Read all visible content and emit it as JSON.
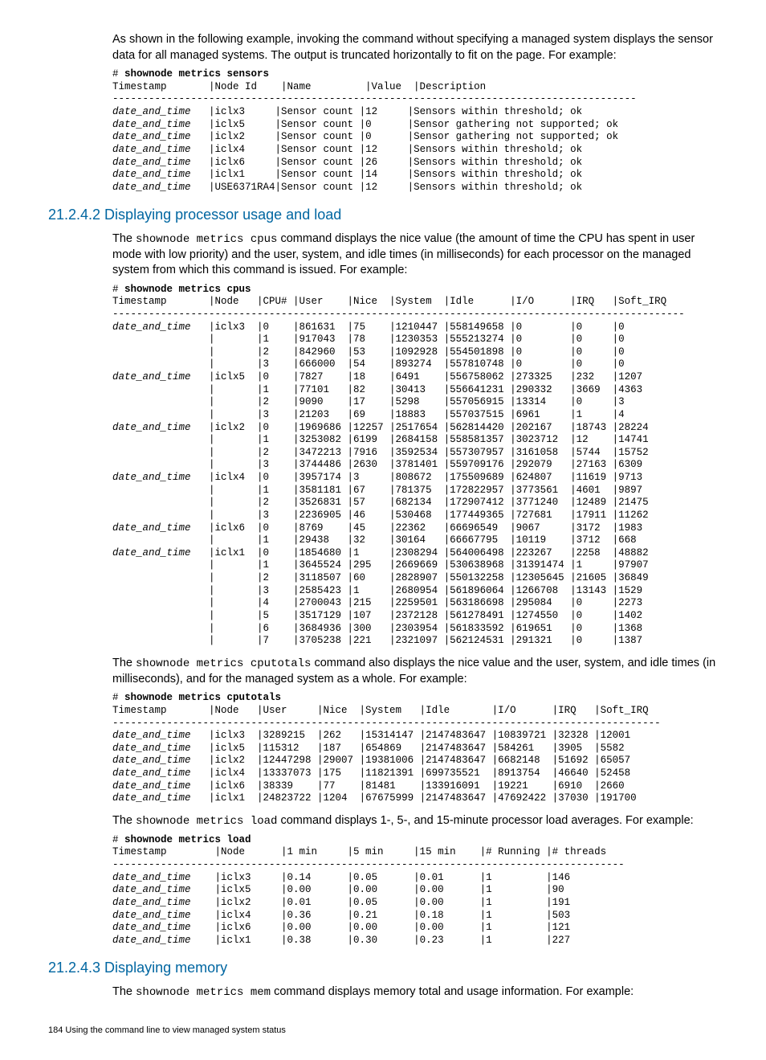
{
  "intro_para": "As shown in the following example, invoking the command without specifying a managed system displays the sensor data for all managed systems. The output is truncated horizontally to fit on the page. For example:",
  "sensors_block": {
    "cmd": "# shownode metrics sensors",
    "header": "Timestamp       |Node Id    |Name         |Value  |Description",
    "sep": "---------------------------------------------------------------------------------------",
    "rows": [
      {
        "ts": "date_and_time",
        "node": "iclx3",
        "name": "Sensor count",
        "val": "12",
        "desc": "Sensors within threshold; ok"
      },
      {
        "ts": "date_and_time",
        "node": "iclx5",
        "name": "Sensor count",
        "val": "0",
        "desc": "Sensor gathering not supported; ok"
      },
      {
        "ts": "date_and_time",
        "node": "iclx2",
        "name": "Sensor count",
        "val": "0",
        "desc": "Sensor gathering not supported; ok"
      },
      {
        "ts": "date_and_time",
        "node": "iclx4",
        "name": "Sensor count",
        "val": "12",
        "desc": "Sensors within threshold; ok"
      },
      {
        "ts": "date_and_time",
        "node": "iclx6",
        "name": "Sensor count",
        "val": "26",
        "desc": "Sensors within threshold; ok"
      },
      {
        "ts": "date_and_time",
        "node": "iclx1",
        "name": "Sensor count",
        "val": "14",
        "desc": "Sensors within threshold; ok"
      },
      {
        "ts": "date_and_time",
        "node": "USE6371RA4",
        "name": "Sensor count",
        "val": "12",
        "desc": "Sensors within threshold; ok"
      }
    ]
  },
  "sec2_title": "21.2.4.2 Displaying processor usage and load",
  "sec2_para_pre": "The ",
  "sec2_para_mono": "shownode metrics cpus",
  "sec2_para_post": " command displays the nice value (the amount of time the CPU has spent in user mode with low priority) and the user, system, and idle times (in milliseconds) for each processor on the managed system from which this command is issued. For example:",
  "cpus_block": {
    "cmd": "# shownode metrics cpus",
    "header": "Timestamp       |Node   |CPU# |User    |Nice  |System  |Idle      |I/O      |IRQ   |Soft_IRQ",
    "sep": "-----------------------------------------------------------------------------------------------",
    "rows": [
      {
        "ts": "date_and_time",
        "node": "iclx3",
        "cpu": "0",
        "user": "861631",
        "nice": "75",
        "sys": "1210447",
        "idle": "558149658",
        "io": "0",
        "irq": "0",
        "sirq": "0"
      },
      {
        "ts": "",
        "node": "",
        "cpu": "1",
        "user": "917043",
        "nice": "78",
        "sys": "1230353",
        "idle": "555213274",
        "io": "0",
        "irq": "0",
        "sirq": "0"
      },
      {
        "ts": "",
        "node": "",
        "cpu": "2",
        "user": "842960",
        "nice": "53",
        "sys": "1092928",
        "idle": "554501898",
        "io": "0",
        "irq": "0",
        "sirq": "0"
      },
      {
        "ts": "",
        "node": "",
        "cpu": "3",
        "user": "666000",
        "nice": "54",
        "sys": "893274",
        "idle": "557810748",
        "io": "0",
        "irq": "0",
        "sirq": "0"
      },
      {
        "ts": "date_and_time",
        "node": "iclx5",
        "cpu": "0",
        "user": "7827",
        "nice": "18",
        "sys": "6491",
        "idle": "556758062",
        "io": "273325",
        "irq": "232",
        "sirq": "1207"
      },
      {
        "ts": "",
        "node": "",
        "cpu": "1",
        "user": "77101",
        "nice": "82",
        "sys": "30413",
        "idle": "556641231",
        "io": "290332",
        "irq": "3669",
        "sirq": "4363"
      },
      {
        "ts": "",
        "node": "",
        "cpu": "2",
        "user": "9090",
        "nice": "17",
        "sys": "5298",
        "idle": "557056915",
        "io": "13314",
        "irq": "0",
        "sirq": "3"
      },
      {
        "ts": "",
        "node": "",
        "cpu": "3",
        "user": "21203",
        "nice": "69",
        "sys": "18883",
        "idle": "557037515",
        "io": "6961",
        "irq": "1",
        "sirq": "4"
      },
      {
        "ts": "date_and_time",
        "node": "iclx2",
        "cpu": "0",
        "user": "1969686",
        "nice": "12257",
        "sys": "2517654",
        "idle": "562814420",
        "io": "202167",
        "irq": "18743",
        "sirq": "28224"
      },
      {
        "ts": "",
        "node": "",
        "cpu": "1",
        "user": "3253082",
        "nice": "6199",
        "sys": "2684158",
        "idle": "558581357",
        "io": "3023712",
        "irq": "12",
        "sirq": "14741"
      },
      {
        "ts": "",
        "node": "",
        "cpu": "2",
        "user": "3472213",
        "nice": "7916",
        "sys": "3592534",
        "idle": "557307957",
        "io": "3161058",
        "irq": "5744",
        "sirq": "15752"
      },
      {
        "ts": "",
        "node": "",
        "cpu": "3",
        "user": "3744486",
        "nice": "2630",
        "sys": "3781401",
        "idle": "559709176",
        "io": "292079",
        "irq": "27163",
        "sirq": "6309"
      },
      {
        "ts": "date_and_time",
        "node": "iclx4",
        "cpu": "0",
        "user": "3957174",
        "nice": "3",
        "sys": "808672",
        "idle": "175509689",
        "io": "624807",
        "irq": "11619",
        "sirq": "9713"
      },
      {
        "ts": "",
        "node": "",
        "cpu": "1",
        "user": "3581181",
        "nice": "67",
        "sys": "781375",
        "idle": "172822957",
        "io": "3773561",
        "irq": "4601",
        "sirq": "9897"
      },
      {
        "ts": "",
        "node": "",
        "cpu": "2",
        "user": "3526831",
        "nice": "57",
        "sys": "682134",
        "idle": "172907412",
        "io": "3771240",
        "irq": "12489",
        "sirq": "21475"
      },
      {
        "ts": "",
        "node": "",
        "cpu": "3",
        "user": "2236905",
        "nice": "46",
        "sys": "530468",
        "idle": "177449365",
        "io": "727681",
        "irq": "17911",
        "sirq": "11262"
      },
      {
        "ts": "date_and_time",
        "node": "iclx6",
        "cpu": "0",
        "user": "8769",
        "nice": "45",
        "sys": "22362",
        "idle": "66696549",
        "io": "9067",
        "irq": "3172",
        "sirq": "1983"
      },
      {
        "ts": "",
        "node": "",
        "cpu": "1",
        "user": "29438",
        "nice": "32",
        "sys": "30164",
        "idle": "66667795",
        "io": "10119",
        "irq": "3712",
        "sirq": "668"
      },
      {
        "ts": "date_and_time",
        "node": "iclx1",
        "cpu": "0",
        "user": "1854680",
        "nice": "1",
        "sys": "2308294",
        "idle": "564006498",
        "io": "223267",
        "irq": "2258",
        "sirq": "48882"
      },
      {
        "ts": "",
        "node": "",
        "cpu": "1",
        "user": "3645524",
        "nice": "295",
        "sys": "2669669",
        "idle": "530638968",
        "io": "31391474",
        "irq": "1",
        "sirq": "97907"
      },
      {
        "ts": "",
        "node": "",
        "cpu": "2",
        "user": "3118507",
        "nice": "60",
        "sys": "2828907",
        "idle": "550132258",
        "io": "12305645",
        "irq": "21605",
        "sirq": "36849"
      },
      {
        "ts": "",
        "node": "",
        "cpu": "3",
        "user": "2585423",
        "nice": "1",
        "sys": "2680954",
        "idle": "561896064",
        "io": "1266708",
        "irq": "13143",
        "sirq": "1529"
      },
      {
        "ts": "",
        "node": "",
        "cpu": "4",
        "user": "2700043",
        "nice": "215",
        "sys": "2259501",
        "idle": "563186698",
        "io": "295084",
        "irq": "0",
        "sirq": "2273"
      },
      {
        "ts": "",
        "node": "",
        "cpu": "5",
        "user": "3517129",
        "nice": "107",
        "sys": "2372128",
        "idle": "561278491",
        "io": "1274550",
        "irq": "0",
        "sirq": "1402"
      },
      {
        "ts": "",
        "node": "",
        "cpu": "6",
        "user": "3684936",
        "nice": "300",
        "sys": "2303954",
        "idle": "561833592",
        "io": "619651",
        "irq": "0",
        "sirq": "1368"
      },
      {
        "ts": "",
        "node": "",
        "cpu": "7",
        "user": "3705238",
        "nice": "221",
        "sys": "2321097",
        "idle": "562124531",
        "io": "291321",
        "irq": "0",
        "sirq": "1387"
      }
    ]
  },
  "cputotals_pre": "The ",
  "cputotals_mono": "shownode metrics cputotals",
  "cputotals_post": " command also displays the nice value and the user, system, and idle times (in milliseconds), and for the managed system as a whole. For example:",
  "cputotals_block": {
    "cmd": "# shownode metrics cputotals",
    "header": "Timestamp       |Node   |User     |Nice  |System   |Idle       |I/O      |IRQ   |Soft_IRQ",
    "sep": "-------------------------------------------------------------------------------------------",
    "rows": [
      {
        "ts": "date_and_time",
        "node": "iclx3",
        "user": "3289215",
        "nice": "262",
        "sys": "15314147",
        "idle": "2147483647",
        "io": "10839721",
        "irq": "32328",
        "sirq": "12001"
      },
      {
        "ts": "date_and_time",
        "node": "iclx5",
        "user": "115312",
        "nice": "187",
        "sys": "654869",
        "idle": "2147483647",
        "io": "584261",
        "irq": "3905",
        "sirq": "5582"
      },
      {
        "ts": "date_and_time",
        "node": "iclx2",
        "user": "12447298",
        "nice": "29007",
        "sys": "19381006",
        "idle": "2147483647",
        "io": "6682148",
        "irq": "51692",
        "sirq": "65057"
      },
      {
        "ts": "date_and_time",
        "node": "iclx4",
        "user": "13337073",
        "nice": "175",
        "sys": "11821391",
        "idle": "699735521",
        "io": "8913754",
        "irq": "46640",
        "sirq": "52458"
      },
      {
        "ts": "date_and_time",
        "node": "iclx6",
        "user": "38339",
        "nice": "77",
        "sys": "81481",
        "idle": "133916091",
        "io": "19221",
        "irq": "6910",
        "sirq": "2660"
      },
      {
        "ts": "date_and_time",
        "node": "iclx1",
        "user": "24823722",
        "nice": "1204",
        "sys": "67675999",
        "idle": "2147483647",
        "io": "47692422",
        "irq": "37030",
        "sirq": "191700"
      }
    ]
  },
  "load_pre": "The ",
  "load_mono": "shownode metrics load",
  "load_post": " command displays 1-, 5-, and 15-minute processor load averages. For example:",
  "load_block": {
    "cmd": "# shownode metrics load",
    "header": "Timestamp        |Node      |1 min     |5 min     |15 min    |# Running |# threads",
    "sep": "-------------------------------------------------------------------------------------",
    "rows": [
      {
        "ts": "date_and_time",
        "node": "iclx3",
        "m1": "0.14",
        "m5": "0.05",
        "m15": "0.01",
        "run": "1",
        "thr": "146"
      },
      {
        "ts": "date_and_time",
        "node": "iclx5",
        "m1": "0.00",
        "m5": "0.00",
        "m15": "0.00",
        "run": "1",
        "thr": "90"
      },
      {
        "ts": "date_and_time",
        "node": "iclx2",
        "m1": "0.01",
        "m5": "0.05",
        "m15": "0.00",
        "run": "1",
        "thr": "191"
      },
      {
        "ts": "date_and_time",
        "node": "iclx4",
        "m1": "0.36",
        "m5": "0.21",
        "m15": "0.18",
        "run": "1",
        "thr": "503"
      },
      {
        "ts": "date_and_time",
        "node": "iclx6",
        "m1": "0.00",
        "m5": "0.00",
        "m15": "0.00",
        "run": "1",
        "thr": "121"
      },
      {
        "ts": "date_and_time",
        "node": "iclx1",
        "m1": "0.38",
        "m5": "0.30",
        "m15": "0.23",
        "run": "1",
        "thr": "227"
      }
    ]
  },
  "sec3_title": "21.2.4.3 Displaying memory",
  "sec3_para_pre": "The ",
  "sec3_para_mono": "shownode metrics mem",
  "sec3_para_post": " command displays memory total and usage information. For example:",
  "footer": "184   Using the command line to view managed system status"
}
